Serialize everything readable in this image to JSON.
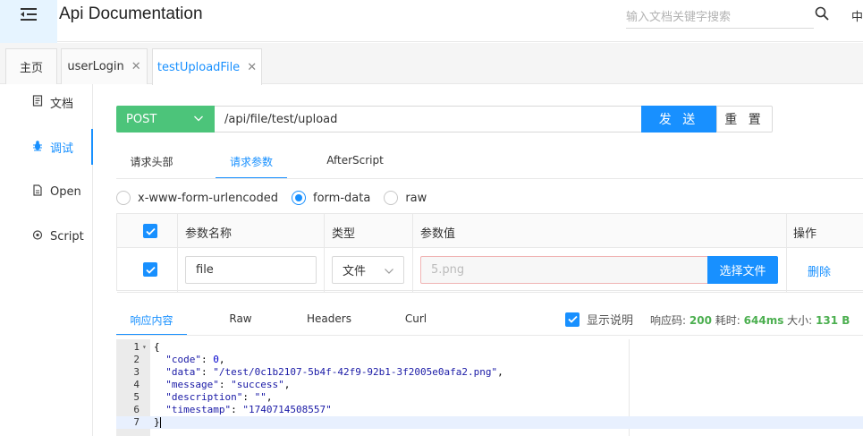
{
  "header": {
    "title": "Api Documentation",
    "search_placeholder": "输入文档关键字搜索",
    "lang": "中"
  },
  "tabs": [
    {
      "label": "主页"
    },
    {
      "label": "userLogin"
    },
    {
      "label": "testUploadFile"
    }
  ],
  "sidebar": {
    "items": [
      {
        "label": "文档",
        "icon": "document-icon"
      },
      {
        "label": "调试",
        "icon": "bug-icon"
      },
      {
        "label": "Open",
        "icon": "file-icon"
      },
      {
        "label": "Script",
        "icon": "code-icon"
      }
    ]
  },
  "request": {
    "method": "POST",
    "url": "/api/file/test/upload",
    "send_label": "发 送",
    "reset_label": "重 置",
    "tabs": [
      "请求头部",
      "请求参数",
      "AfterScript"
    ],
    "active_tab": "请求参数",
    "content_types": [
      "x-www-form-urlencoded",
      "form-data",
      "raw"
    ],
    "selected_content_type": "form-data"
  },
  "params_table": {
    "headers": [
      "参数名称",
      "类型",
      "参数值",
      "操作"
    ],
    "rows": [
      {
        "checked": true,
        "name": "file",
        "type": "文件",
        "value_placeholder": "5.png",
        "choose_label": "选择文件",
        "delete_label": "删除"
      }
    ]
  },
  "response": {
    "tabs": [
      "响应内容",
      "Raw",
      "Headers",
      "Curl"
    ],
    "active_tab": "响应内容",
    "show_desc_label": "显示说明",
    "status_label": "响应码:",
    "status_value": "200",
    "time_label": "耗时:",
    "time_value": "644ms",
    "size_label": "大小:",
    "size_value": "131 B",
    "code_lines": [
      "{",
      "  \"code\": 0,",
      "  \"data\": \"/test/0c1b2107-5b4f-42f9-92b1-3f2005e0afa2.png\",",
      "  \"message\": \"success\",",
      "  \"description\": \"\",",
      "  \"timestamp\": \"1740714508557\"",
      "}"
    ]
  },
  "colors": {
    "primary": "#1890ff",
    "post_method": "#4cc47a",
    "success_stat": "#4caf50"
  }
}
